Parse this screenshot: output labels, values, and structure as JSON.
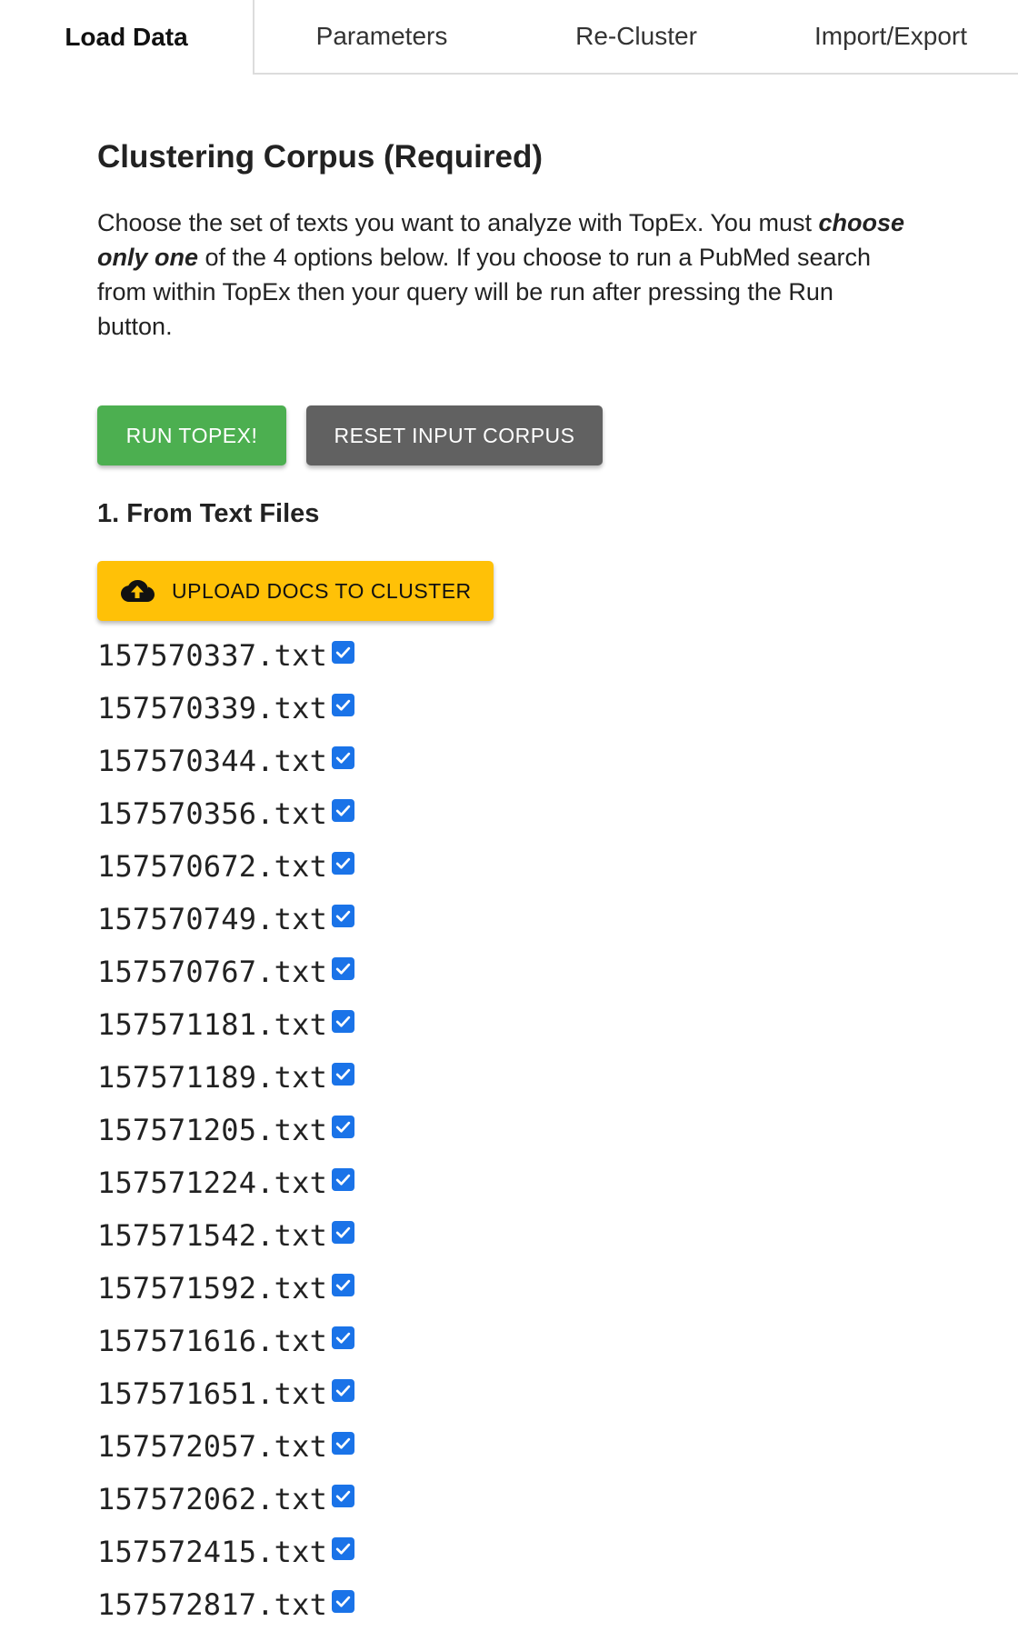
{
  "tabs": [
    {
      "label": "Load Data",
      "active": true
    },
    {
      "label": "Parameters",
      "active": false
    },
    {
      "label": "Re-Cluster",
      "active": false
    },
    {
      "label": "Import/Export",
      "active": false
    }
  ],
  "corpus": {
    "title": "Clustering Corpus (Required)",
    "intro_part1": "Choose the set of texts you want to analyze with TopEx. You must ",
    "intro_emphasis": "choose only one",
    "intro_part2": " of the 4 options below. If you choose to run a PubMed search from within TopEx then your query will be run after pressing the Run button."
  },
  "buttons": {
    "run_label": "RUN TOPEX!",
    "reset_label": "RESET INPUT CORPUS",
    "upload_label": "UPLOAD DOCS TO CLUSTER"
  },
  "section": {
    "title": "1. From Text Files"
  },
  "icons": {
    "upload": "cloud-upload-icon",
    "checkbox": "checkbox-checked-icon"
  },
  "colors": {
    "run": "#4caf50",
    "reset": "#616161",
    "upload": "#ffc107",
    "checkbox": "#1a73e8"
  },
  "files": [
    {
      "name": "157570337.txt",
      "checked": true
    },
    {
      "name": "157570339.txt",
      "checked": true
    },
    {
      "name": "157570344.txt",
      "checked": true
    },
    {
      "name": "157570356.txt",
      "checked": true
    },
    {
      "name": "157570672.txt",
      "checked": true
    },
    {
      "name": "157570749.txt",
      "checked": true
    },
    {
      "name": "157570767.txt",
      "checked": true
    },
    {
      "name": "157571181.txt",
      "checked": true
    },
    {
      "name": "157571189.txt",
      "checked": true
    },
    {
      "name": "157571205.txt",
      "checked": true
    },
    {
      "name": "157571224.txt",
      "checked": true
    },
    {
      "name": "157571542.txt",
      "checked": true
    },
    {
      "name": "157571592.txt",
      "checked": true
    },
    {
      "name": "157571616.txt",
      "checked": true
    },
    {
      "name": "157571651.txt",
      "checked": true
    },
    {
      "name": "157572057.txt",
      "checked": true
    },
    {
      "name": "157572062.txt",
      "checked": true
    },
    {
      "name": "157572415.txt",
      "checked": true
    },
    {
      "name": "157572817.txt",
      "checked": true
    }
  ]
}
